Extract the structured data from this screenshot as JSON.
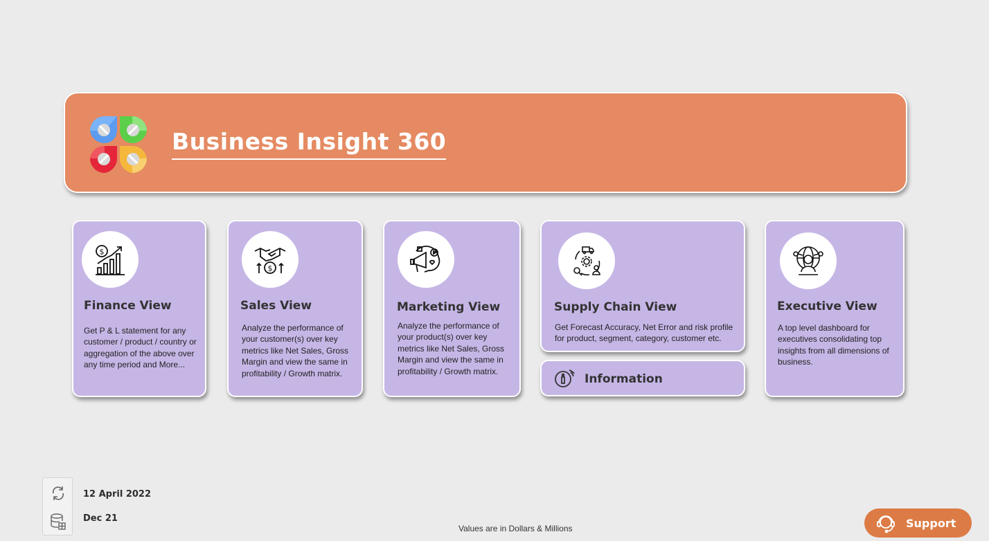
{
  "header": {
    "title": "Business Insight 360"
  },
  "cards": [
    {
      "title": "Finance View",
      "description": "Get P & L statement for any customer / product / country or aggregation of the above over any time period and More...",
      "icon": "finance-growth-icon"
    },
    {
      "title": "Sales View",
      "description": "Analyze the performance of your customer(s) over key metrics like Net Sales, Gross Margin and view the same in profitability / Growth matrix.",
      "icon": "handshake-dollar-icon"
    },
    {
      "title": "Marketing View",
      "description": "Analyze the performance of your product(s) over key metrics like Net Sales, Gross Margin and view the same in profitability / Growth matrix.",
      "icon": "marketing-megaphone-icon"
    },
    {
      "title": "Supply Chain View",
      "description": "Get Forecast Accuracy, Net Error and risk profile for product, segment, category, customer etc.",
      "icon": "supply-chain-icon"
    },
    {
      "title": "Executive View",
      "description": "A top level dashboard for executives consolidating top insights from all dimensions of business.",
      "icon": "executive-globe-icon"
    }
  ],
  "info": {
    "label": "Information"
  },
  "status": {
    "refresh_date": "12 April 2022",
    "data_period": "Dec 21"
  },
  "footer": {
    "note": "Values are in Dollars & Millions"
  },
  "support": {
    "label": "Support"
  },
  "colors": {
    "banner": "#e58a62",
    "card": "#c6b6e6",
    "support": "#dc7b45",
    "background": "#ebebeb"
  }
}
